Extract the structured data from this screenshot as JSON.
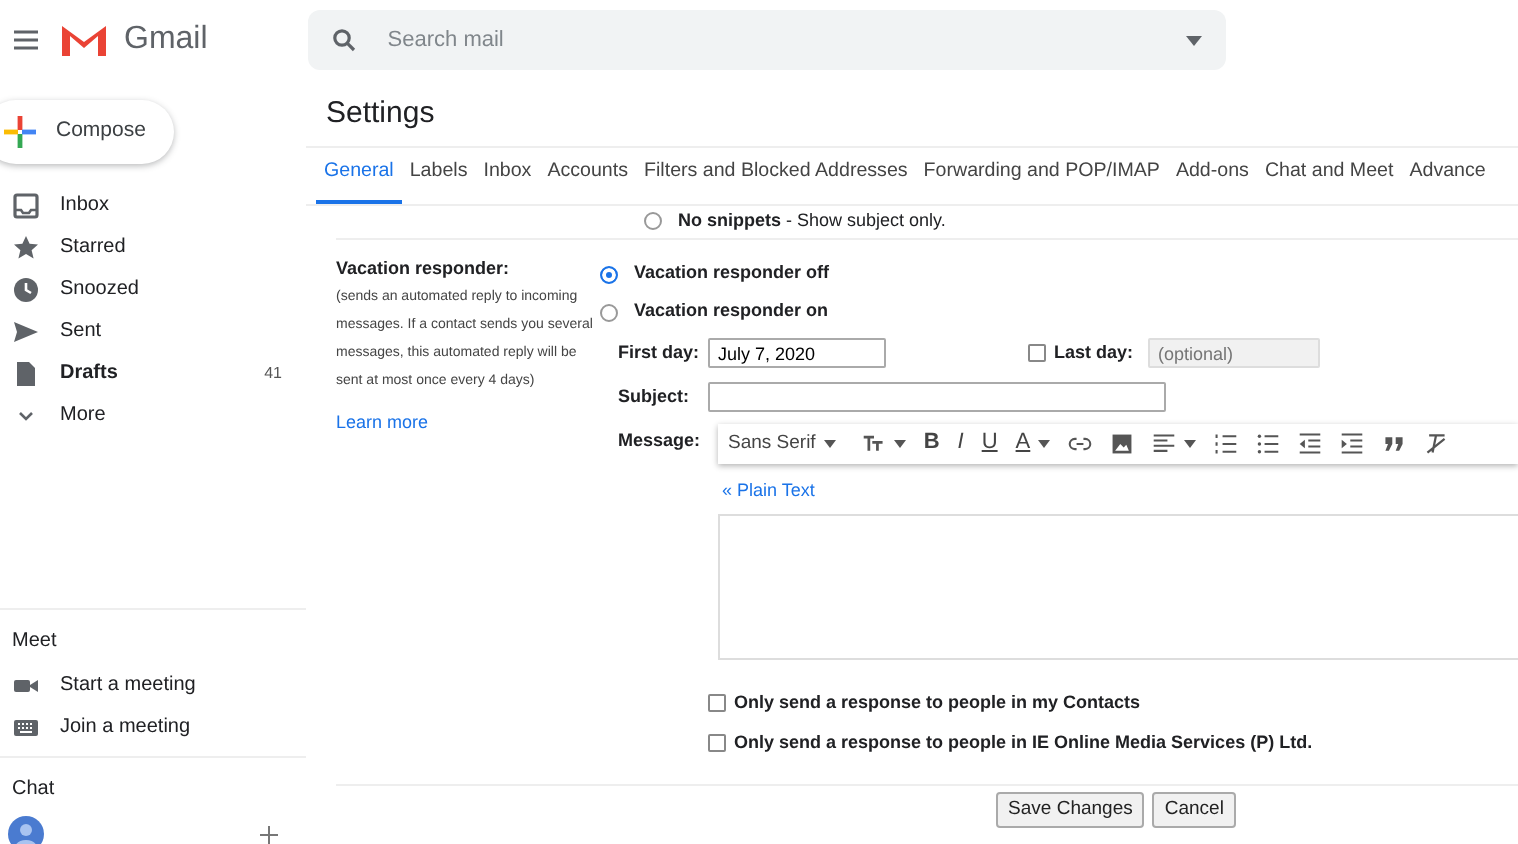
{
  "header": {
    "app_name": "Gmail",
    "search": {
      "placeholder": "Search mail"
    }
  },
  "sidebar": {
    "compose": "Compose",
    "items": [
      {
        "kind": "inbox",
        "label": "Inbox",
        "unread": false
      },
      {
        "kind": "star",
        "label": "Starred",
        "unread": false
      },
      {
        "kind": "clock",
        "label": "Snoozed",
        "unread": false
      },
      {
        "kind": "send",
        "label": "Sent",
        "unread": false
      },
      {
        "kind": "file",
        "label": "Drafts",
        "unread": true,
        "count": "41"
      },
      {
        "kind": "chevron",
        "label": "More",
        "unread": false
      }
    ],
    "meet": {
      "title": "Meet",
      "items": [
        {
          "kind": "video",
          "label": "Start a meeting"
        },
        {
          "kind": "keyboard",
          "label": "Join a meeting"
        }
      ]
    },
    "chat": {
      "title": "Chat"
    }
  },
  "settings": {
    "title": "Settings",
    "tabs": [
      {
        "label": "General",
        "selected": true
      },
      {
        "label": "Labels",
        "selected": false
      },
      {
        "label": "Inbox",
        "selected": false
      },
      {
        "label": "Accounts",
        "selected": false
      },
      {
        "label": "Filters and Blocked Addresses",
        "selected": false
      },
      {
        "label": "Forwarding and POP/IMAP",
        "selected": false
      },
      {
        "label": "Add-ons",
        "selected": false
      },
      {
        "label": "Chat and Meet",
        "selected": false
      },
      {
        "label": "Advance",
        "selected": false
      }
    ],
    "snippets_option": {
      "text": "**No snippets** - Show subject only.",
      "selected": false
    },
    "vacation": {
      "label": "Vacation responder:",
      "description": "(sends an automated reply to incoming messages. If a contact sends you several messages, this automated reply will be sent at most once every 4 days)",
      "learn_more": "Learn more",
      "options": [
        {
          "label": "Vacation responder off",
          "selected": true
        },
        {
          "label": "Vacation responder on",
          "selected": false
        }
      ],
      "first_day": {
        "label": "First day:",
        "value": "July 7, 2020"
      },
      "last_day": {
        "label": "Last day:",
        "checked": false,
        "placeholder": "(optional)"
      },
      "subject": {
        "label": "Subject:"
      },
      "message": {
        "label": "Message:",
        "plain_text_link": "« Plain Text",
        "toolbar": [
          {
            "kind": "font",
            "label": "Sans Serif"
          },
          {
            "kind": "size"
          },
          {
            "kind": "bold",
            "label": "B"
          },
          {
            "kind": "italic",
            "label": "I"
          },
          {
            "kind": "underline",
            "label": "U"
          },
          {
            "kind": "color",
            "label": "A"
          },
          {
            "kind": "link"
          },
          {
            "kind": "image"
          },
          {
            "kind": "align"
          },
          {
            "kind": "numbered"
          },
          {
            "kind": "bulleted"
          },
          {
            "kind": "outdent"
          },
          {
            "kind": "indent"
          },
          {
            "kind": "quote"
          },
          {
            "kind": "clear"
          }
        ]
      },
      "restrictions": [
        {
          "label": "Only send a response to people in my Contacts",
          "checked": false
        },
        {
          "label": "Only send a response to people in IE Online Media Services (P) Ltd.",
          "checked": false
        }
      ]
    },
    "buttons": [
      "Save Changes",
      "Cancel"
    ]
  }
}
